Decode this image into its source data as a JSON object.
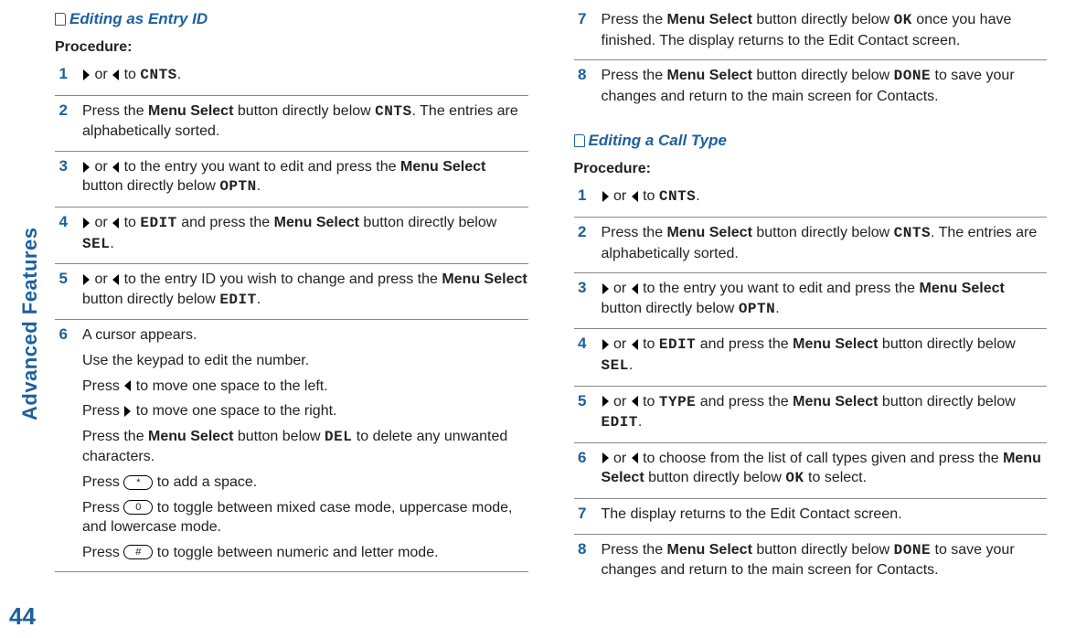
{
  "sidebar": {
    "label": "Advanced Features",
    "pageNumber": "44"
  },
  "section1": {
    "title": "Editing as Entry ID",
    "procedureLabel": "Procedure:",
    "steps": {
      "s1": {
        "num": "1",
        "or": " or ",
        "to": " to ",
        "cnts": "CNTS",
        "end": "."
      },
      "s2": {
        "num": "2",
        "t1": "Press the ",
        "ms": "Menu Select",
        "t2": " button directly below ",
        "cnts": "CNTS",
        "t3": ". The entries are alphabetically sorted."
      },
      "s3": {
        "num": "3",
        "or": " or ",
        "t1": " to the entry you want to edit and press the ",
        "ms": "Menu Select",
        "t2": " button directly below ",
        "optn": "OPTN",
        "end": "."
      },
      "s4": {
        "num": "4",
        "or": " or ",
        "to": " to ",
        "edit": "EDIT",
        "t1": " and press the ",
        "ms": "Menu Select",
        "t2": " button directly below ",
        "sel": "SEL",
        "end": "."
      },
      "s5": {
        "num": "5",
        "or": " or ",
        "t1": " to the entry ID you wish to change and press the ",
        "ms": "Menu Select",
        "t2": " button directly below ",
        "edit": "EDIT",
        "end": "."
      },
      "s6": {
        "num": "6",
        "p1": "A cursor appears.",
        "p2": "Use the keypad to edit the number.",
        "p3a": "Press ",
        "p3b": " to move one space to the left.",
        "p4a": "Press ",
        "p4b": " to move one space to the right.",
        "p5a": "Press the ",
        "ms": "Menu Select",
        "p5b": " button below ",
        "del": "DEL",
        "p5c": " to delete any unwanted characters.",
        "p6a": "Press ",
        "keyStar": "*",
        "p6b": " to add a space.",
        "p7a": "Press ",
        "keyZero": "0",
        "p7b": " to toggle between mixed case mode, uppercase mode, and lowercase mode.",
        "p8a": "Press ",
        "keyHash": "#",
        "p8b": " to toggle between numeric and letter mode."
      }
    }
  },
  "section2_top": {
    "steps": {
      "s7": {
        "num": "7",
        "t1": "Press the ",
        "ms": "Menu Select",
        "t2": " button directly below ",
        "ok": "OK",
        "t3": " once you have finished. The display returns to the Edit Contact screen."
      },
      "s8": {
        "num": "8",
        "t1": "Press the ",
        "ms": "Menu Select",
        "t2": " button directly below ",
        "done": "DONE",
        "t3": " to save your changes and return to the main screen for Contacts."
      }
    }
  },
  "section3": {
    "title": "Editing a Call Type",
    "procedureLabel": "Procedure:",
    "steps": {
      "s1": {
        "num": "1",
        "or": " or ",
        "to": " to ",
        "cnts": "CNTS",
        "end": "."
      },
      "s2": {
        "num": "2",
        "t1": "Press the ",
        "ms": "Menu Select",
        "t2": " button directly below ",
        "cnts": "CNTS",
        "t3": ". The entries are alphabetically sorted."
      },
      "s3": {
        "num": "3",
        "or": " or ",
        "t1": " to the entry you want to edit and press the ",
        "ms": "Menu Select",
        "t2": " button directly below ",
        "optn": "OPTN",
        "end": "."
      },
      "s4": {
        "num": "4",
        "or": " or ",
        "to": " to ",
        "edit": "EDIT",
        "t1": " and press the ",
        "ms": "Menu Select",
        "t2": " button directly below ",
        "sel": "SEL",
        "end": "."
      },
      "s5": {
        "num": "5",
        "or": " or ",
        "to": " to ",
        "type": "TYPE",
        "t1": " and press the ",
        "ms": "Menu Select",
        "t2": " button directly below ",
        "edit": "EDIT",
        "end": "."
      },
      "s6": {
        "num": "6",
        "or": " or ",
        "t1": " to choose from the list of call types given and press the ",
        "ms": "Menu Select",
        "t2": " button directly below ",
        "ok": "OK",
        "t3": " to select."
      },
      "s7": {
        "num": "7",
        "t1": "The display returns to the Edit Contact screen."
      },
      "s8": {
        "num": "8",
        "t1": "Press the ",
        "ms": "Menu Select",
        "t2": " button directly below ",
        "done": "DONE",
        "t3": " to save your changes and return to the main screen for Contacts."
      }
    }
  }
}
